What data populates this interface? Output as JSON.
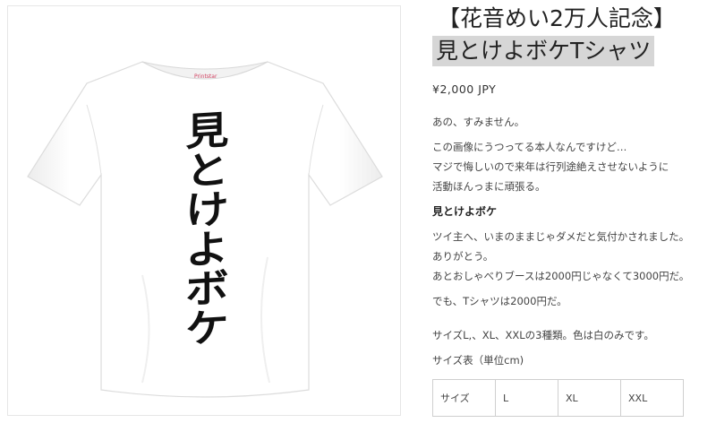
{
  "product": {
    "title_line1": "【花音めい2万人記念】",
    "title_line2": "見とけよボケTシャツ",
    "price": "¥2,000 JPY",
    "shirt_print": [
      "見",
      "と",
      "け",
      "よ",
      "ボ",
      "ケ"
    ],
    "shirt_tag": "Printstar"
  },
  "description": {
    "p1": "あの、すみません。",
    "p2_lines": [
      "この画像にうつってる本人なんですけど…",
      "マジで悔しいので来年は行列途絶えさせないように",
      "活動ほんっまに頑張る。"
    ],
    "subheading": "見とけよボケ",
    "p3_lines": [
      "ツイ主へ、いまのままじゃダメだと気付かされました。",
      "ありがとう。",
      "あとおしゃべりブースは2000円じゃなくて3000円だ。"
    ],
    "p4": "でも、Tシャツは2000円だ。",
    "p5": "サイズL,、XL、XXLの3種類。色は白のみです。",
    "p6": "サイズ表（単位cm)"
  },
  "size_table": {
    "header": [
      "サイズ",
      "L",
      "XL",
      "XXL"
    ]
  },
  "colors": {
    "title_highlight": "#d6d6d6",
    "shirt": "#ffffff",
    "shirt_shadow": "#e4e4e4"
  }
}
